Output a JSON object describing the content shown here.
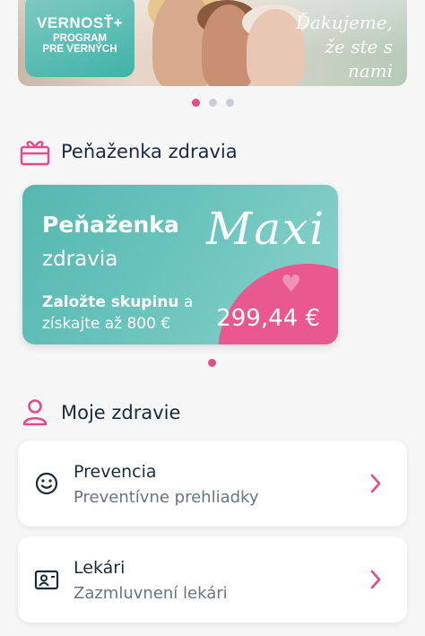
{
  "banner": {
    "badge_line1": "VERNOSŤ+",
    "badge_line2": "PROGRAM",
    "badge_line3": "PRE VERNÝCH",
    "script_text": "Ďakujeme, že ste s nami"
  },
  "banner_pager": {
    "count": 3,
    "active": 1
  },
  "wallet_section": {
    "title": "Peňaženka zdravia",
    "icon": "gift-icon"
  },
  "wallet_card": {
    "title": "Peňaženka",
    "subtitle": "zdravia",
    "tier": "Maxi",
    "text_bold": "Založte skupinu",
    "text_rest1": " a",
    "text_rest2": "získajte až 800 €",
    "amount": "299,44 €"
  },
  "wallet_pager": {
    "count": 1,
    "active": 1
  },
  "health_section": {
    "title": "Moje zdravie",
    "icon": "person-icon"
  },
  "cards": [
    {
      "title": "Prevencia",
      "subtitle": "Preventívne prehliadky",
      "icon": "smiley-icon"
    },
    {
      "title": "Lekári",
      "subtitle": "Zazmluvnení lekári",
      "icon": "doctor-card-icon"
    }
  ],
  "colors": {
    "accent": "#e24c8c",
    "teal": "#55b8b0",
    "text": "#1b2b3a"
  }
}
